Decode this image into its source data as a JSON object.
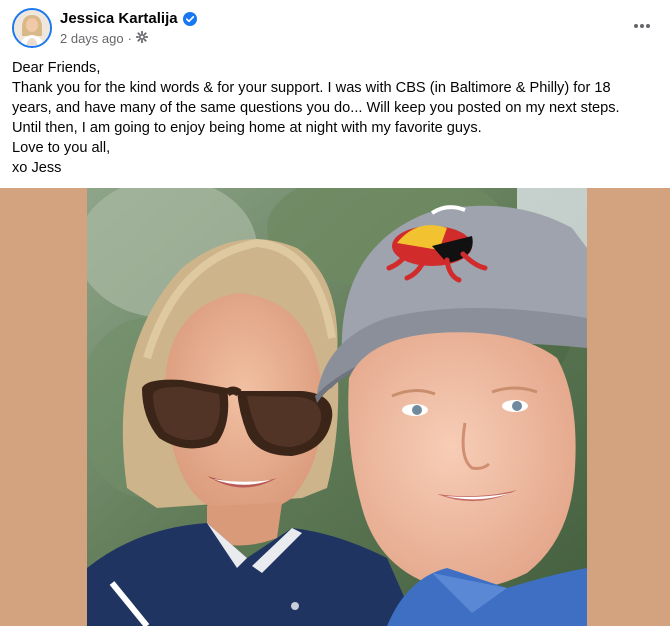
{
  "post": {
    "author": "Jessica Kartalija",
    "verified": true,
    "timestamp": "2 days ago",
    "separator": "·",
    "audience_icon": "public-settings-icon",
    "more_icon": "more-options-icon",
    "lines": [
      "Dear Friends,",
      "Thank you for the kind words & for your support. I was with CBS (in Baltimore & Philly) for 18 years, and have many of the same questions you do... Will keep you posted on my next steps.",
      "Until then, I am going to enjoy being home at night with my favorite guys.",
      "Love to you all,",
      "xo Jess"
    ]
  },
  "colors": {
    "media_background": "#d3a27e",
    "link_blue": "#1877f2",
    "secondary_text": "#65676b"
  }
}
